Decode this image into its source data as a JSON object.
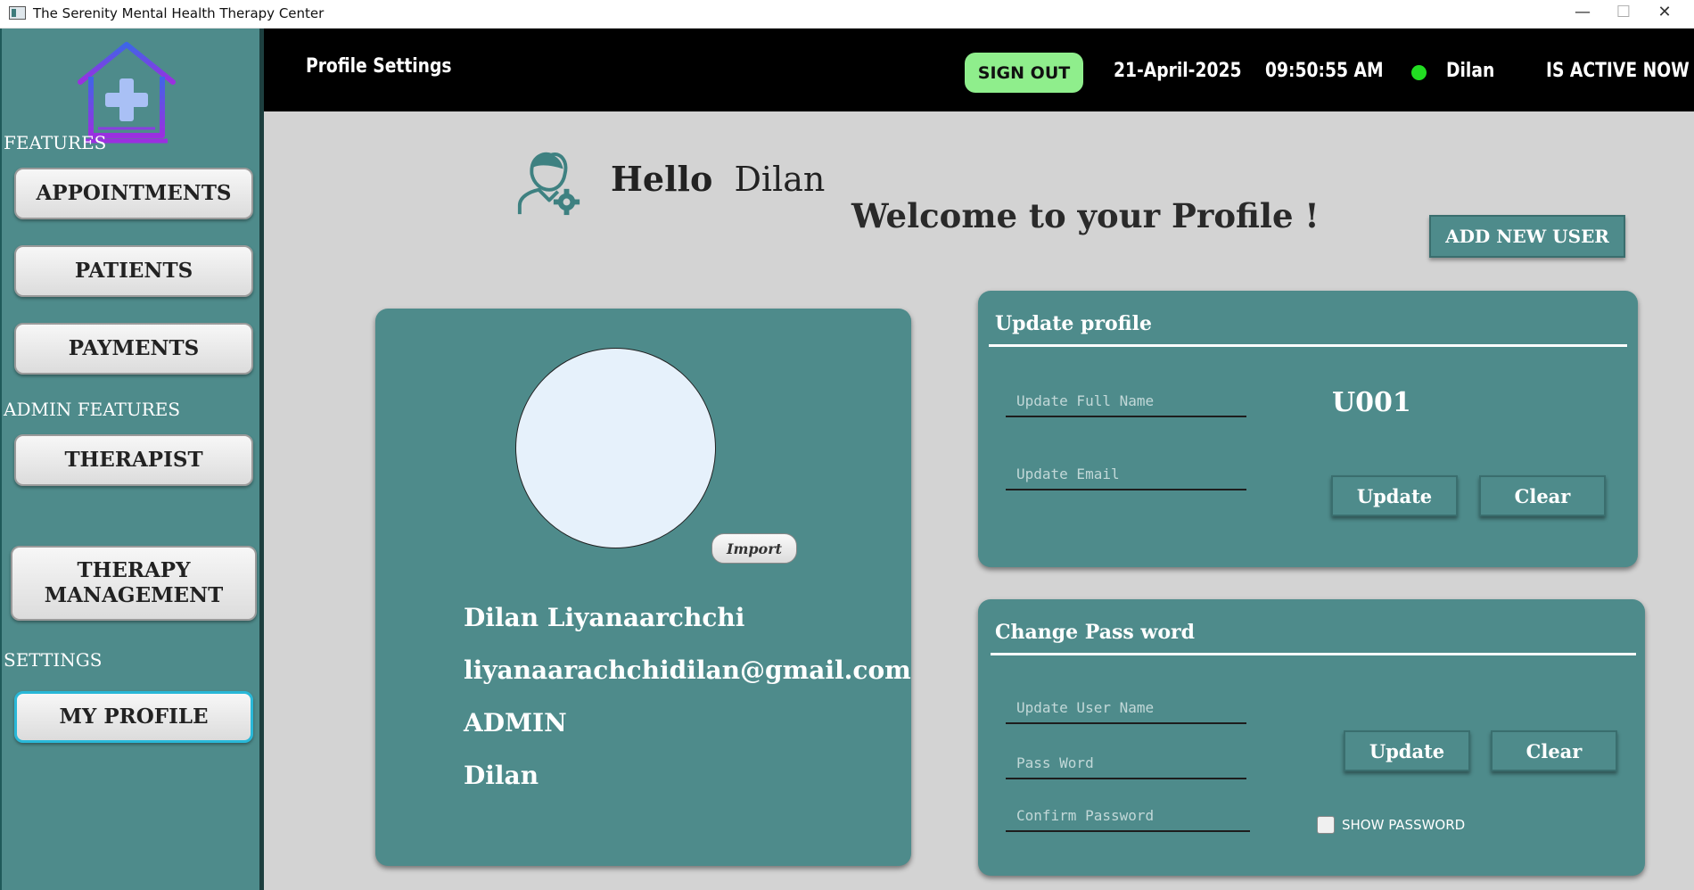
{
  "window": {
    "title": "The Serenity Mental Health Therapy Center",
    "minimize_glyph": "—",
    "maximize_glyph": "☐",
    "close_glyph": "✕"
  },
  "sidebar": {
    "features_label": "FEATURES",
    "admin_label": "ADMIN FEATURES",
    "settings_label": "SETTINGS",
    "appointments": "APPOINTMENTS",
    "patients": "PATIENTS",
    "payments": "PAYMENTS",
    "therapist": "THERAPIST",
    "therapy_mgmt_line1": "THERAPY",
    "therapy_mgmt_line2": "MANAGEMENT",
    "my_profile": "MY PROFILE"
  },
  "header": {
    "page_title": "Profile Settings",
    "sign_out": "SIGN OUT",
    "date": "21-April-2025",
    "time": "09:50:55  AM",
    "user": "Dilan",
    "status": "IS ACTIVE NOW",
    "status_color": "#22dd22"
  },
  "main": {
    "hello": "Hello",
    "hello_name": "Dilan",
    "welcome": "Welcome to your Profile !",
    "add_new_user": "ADD NEW USER"
  },
  "profile_card": {
    "import": "Import",
    "full_name": "Dilan Liyanaarchchi",
    "email": "liyanaarachchidilan@gmail.com",
    "role": "ADMIN",
    "username": "Dilan"
  },
  "update_profile": {
    "title": "Update profile",
    "full_name_placeholder": "Update Full Name",
    "email_placeholder": "Update Email",
    "user_id": "U001",
    "update": "Update",
    "clear": "Clear"
  },
  "change_password": {
    "title": "Change Pass word",
    "username_placeholder": "Update User Name",
    "password_placeholder": "Pass Word",
    "confirm_placeholder": "Confirm Password",
    "update": "Update",
    "clear": "Clear",
    "show_password": "SHOW PASSWORD"
  },
  "colors": {
    "teal": "#4e8b8b",
    "header_bg": "#000000",
    "sign_out_bg": "#8fee8c",
    "content_bg": "#d3d3d3"
  }
}
